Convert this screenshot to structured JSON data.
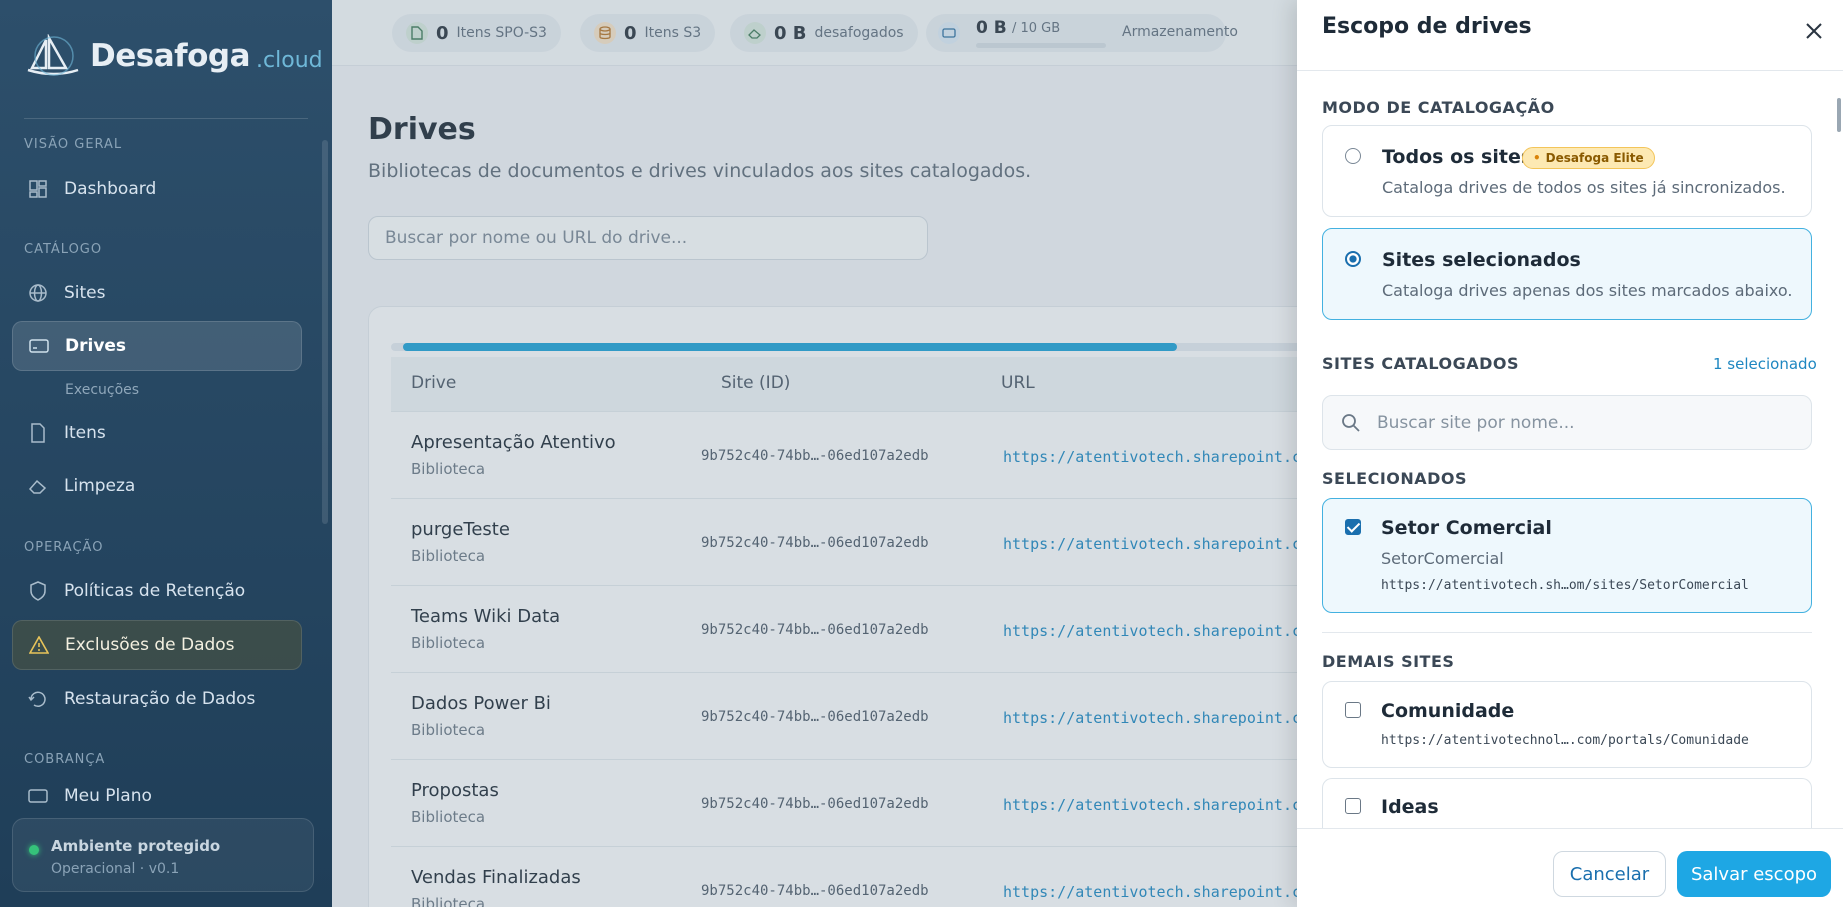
{
  "brand": {
    "name": "Desafoga",
    "tld": ".cloud"
  },
  "sidebar": {
    "sections": [
      "VISÃO GERAL",
      "CATÁLOGO",
      "OPERAÇÃO",
      "COBRANÇA"
    ],
    "items": [
      {
        "label": "Dashboard",
        "icon": "dashboard-icon"
      },
      {
        "label": "Sites",
        "icon": "globe-icon"
      },
      {
        "label": "Drives",
        "icon": "drive-icon"
      },
      {
        "label": "Execuções"
      },
      {
        "label": "Itens",
        "icon": "file-icon"
      },
      {
        "label": "Limpeza",
        "icon": "eraser-icon"
      },
      {
        "label": "Políticas de Retenção",
        "icon": "shield-icon"
      },
      {
        "label": "Exclusões de Dados",
        "icon": "warning-icon"
      },
      {
        "label": "Restauração de Dados",
        "icon": "restore-icon"
      },
      {
        "label": "Meu Plano",
        "icon": "card-icon"
      }
    ],
    "status": {
      "title": "Ambiente protegido",
      "subtitle": "Operacional · v0.1"
    }
  },
  "topbar": {
    "stats": [
      {
        "value": "0",
        "label": "Itens SPO-S3"
      },
      {
        "value": "0",
        "label": "Itens S3"
      },
      {
        "value": "0 B",
        "label": "desafogados"
      },
      {
        "value": "0 B",
        "total": "/ 10 GB",
        "label": "Armazenamento",
        "fill": 0
      }
    ]
  },
  "main": {
    "title": "Drives",
    "subtitle": "Bibliotecas de documentos e drives vinculados aos sites catalogados.",
    "search_placeholder": "Buscar por nome ou URL do drive...",
    "columns": [
      "Drive",
      "Site (ID)",
      "URL"
    ],
    "rows": [
      {
        "name": "Apresentação Atentivo",
        "type": "Biblioteca",
        "site": "9b752c40-74bb…-06ed107a2edb",
        "url": "https://atentivotech.sharepoint.c"
      },
      {
        "name": "purgeTeste",
        "type": "Biblioteca",
        "site": "9b752c40-74bb…-06ed107a2edb",
        "url": "https://atentivotech.sharepoint.c"
      },
      {
        "name": "Teams Wiki Data",
        "type": "Biblioteca",
        "site": "9b752c40-74bb…-06ed107a2edb",
        "url": "https://atentivotech.sharepoint.c"
      },
      {
        "name": "Dados Power Bi",
        "type": "Biblioteca",
        "site": "9b752c40-74bb…-06ed107a2edb",
        "url": "https://atentivotech.sharepoint.c"
      },
      {
        "name": "Propostas",
        "type": "Biblioteca",
        "site": "9b752c40-74bb…-06ed107a2edb",
        "url": "https://atentivotech.sharepoint.c"
      },
      {
        "name": "Vendas Finalizadas",
        "type": "Biblioteca",
        "site": "9b752c40-74bb…-06ed107a2edb",
        "url": "https://atentivotech.sharepoint.c"
      }
    ]
  },
  "panel": {
    "title": "Escopo de drives",
    "mode_section": "MODO DE CATALOGAÇÃO",
    "options": [
      {
        "title": "Todos os sites",
        "badge": "Desafoga Elite",
        "desc": "Cataloga drives de todos os sites já sincronizados."
      },
      {
        "title": "Sites selecionados",
        "desc": "Cataloga drives apenas dos sites marcados abaixo."
      }
    ],
    "sites_section": "SITES CATALOGADOS",
    "selected_count": "1 selecionado",
    "site_search_placeholder": "Buscar site por nome...",
    "selected_section": "SELECIONADOS",
    "selected_sites": [
      {
        "title": "Setor Comercial",
        "sub": "SetorComercial",
        "url": "https://atentivotech.sh…om/sites/SetorComercial"
      }
    ],
    "other_section": "DEMAIS SITES",
    "other_sites": [
      {
        "title": "Comunidade",
        "url": "https://atentivotechnol….com/portals/Comunidade"
      },
      {
        "title": "Ideas"
      }
    ],
    "cancel_label": "Cancelar",
    "save_label": "Salvar escopo"
  },
  "colors": {
    "accent": "#1ea7e4",
    "sidebar": "#2d4f6b",
    "link": "#1e87c1"
  }
}
